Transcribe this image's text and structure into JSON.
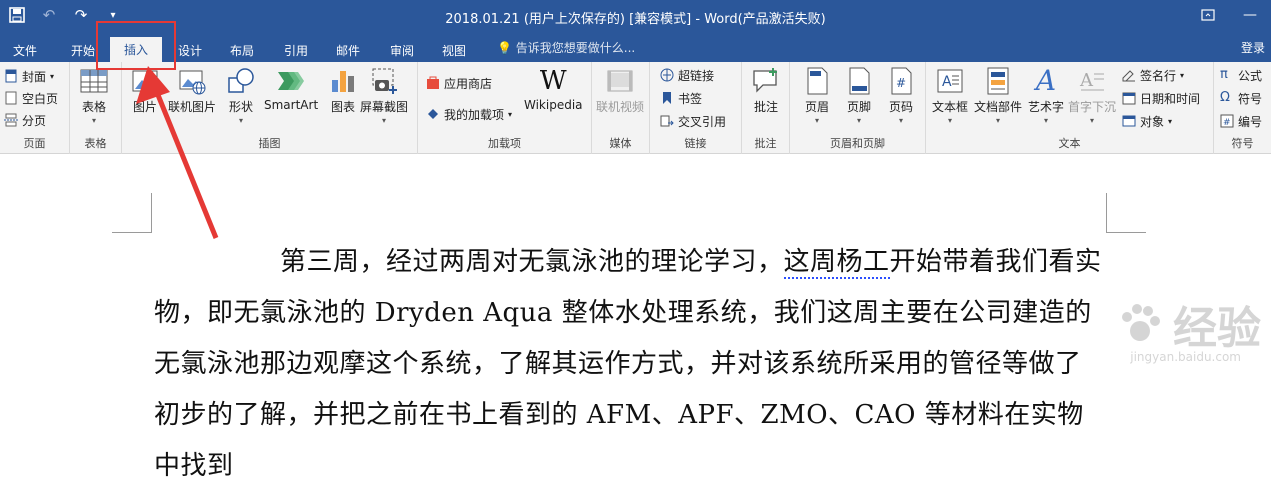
{
  "window": {
    "title": "2018.01.21 (用户上次保存的) [兼容模式] - Word(产品激活失败)"
  },
  "tabs": [
    {
      "label": "文件"
    },
    {
      "label": "开始"
    },
    {
      "label": "插入"
    },
    {
      "label": "设计"
    },
    {
      "label": "布局"
    },
    {
      "label": "引用"
    },
    {
      "label": "邮件"
    },
    {
      "label": "审阅"
    },
    {
      "label": "视图"
    }
  ],
  "tell_me": "告诉我您想要做什么...",
  "sign_in": "登录",
  "ribbon": {
    "pages": {
      "label": "页面",
      "cover": "封面",
      "blank": "空白页",
      "break": "分页"
    },
    "tables": {
      "label": "表格",
      "table": "表格"
    },
    "illustrations": {
      "label": "插图",
      "picture": "图片",
      "online_picture": "联机图片",
      "shapes": "形状",
      "smartart": "SmartArt",
      "chart": "图表",
      "screenshot": "屏幕截图"
    },
    "addins": {
      "label": "加载项",
      "store": "应用商店",
      "my_addins": "我的加载项",
      "wikipedia": "Wikipedia"
    },
    "media": {
      "label": "媒体",
      "online_video": "联机视频"
    },
    "links": {
      "label": "链接",
      "hyperlink": "超链接",
      "bookmark": "书签",
      "cross_ref": "交叉引用"
    },
    "comments": {
      "label": "批注",
      "comment": "批注"
    },
    "header_footer": {
      "label": "页眉和页脚",
      "header": "页眉",
      "footer": "页脚",
      "page_number": "页码"
    },
    "text": {
      "label": "文本",
      "textbox": "文本框",
      "quick_parts": "文档部件",
      "wordart": "艺术字",
      "dropcap": "首字下沉",
      "signature": "签名行",
      "datetime": "日期和时间",
      "object": "对象"
    },
    "symbols": {
      "label": "符号",
      "equation": "公式",
      "symbol": "符号",
      "number": "编号"
    }
  },
  "document": {
    "paragraph_start": "第三周，经过两周对无氯泳池的理论学习，",
    "paragraph_squiggle": "这周杨工",
    "paragraph_rest": "开始带着我们看实物，即无氯泳池的 Dryden Aqua 整体水处理系统，我们这周主要在公司建造的无氯泳池那边观摩这个系统，了解其运作方式，并对该系统所采用的管径等做了初步的了解，并把之前在书上看到的 AFM、APF、ZMO、CAO 等材料在实物中找到"
  },
  "watermark": {
    "text": "经验",
    "url": "jingyan.baidu.com"
  },
  "colors": {
    "brand": "#2b579a",
    "annotation": "#e53935",
    "ribbon_bg": "#f3f3f3"
  }
}
